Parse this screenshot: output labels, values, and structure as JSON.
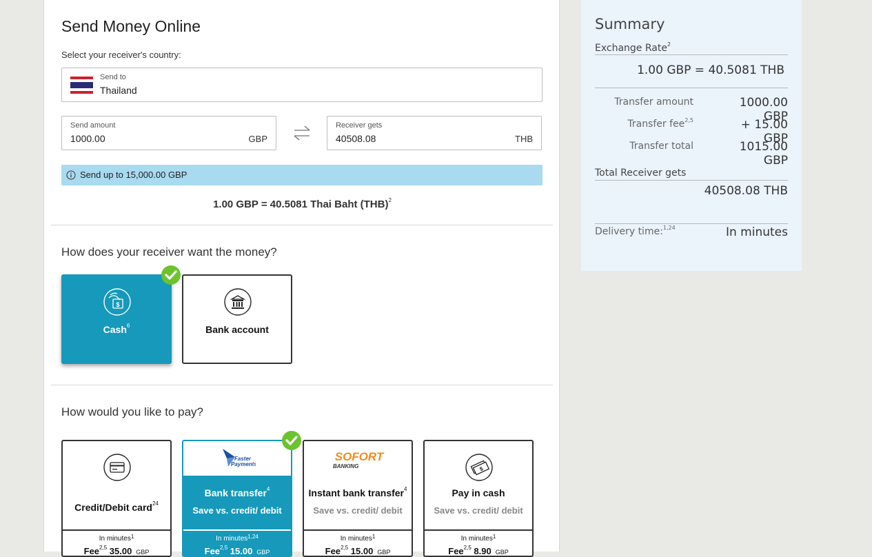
{
  "form": {
    "title": "Send Money Online",
    "country_label": "Select your receiver's country:",
    "send_to_label": "Send to",
    "country_value": "Thailand",
    "send_amount_label": "Send amount",
    "send_amount_value": "1000.00",
    "send_currency": "GBP",
    "receiver_gets_label": "Receiver gets",
    "receiver_gets_value": "40508.08",
    "receiver_currency": "THB",
    "limit_text": "Send up to 15,000.00 GBP",
    "rate_text": "1.00 GBP = 40.5081 Thai Baht (THB)",
    "rate_sup": "2"
  },
  "receive_method": {
    "title": "How does your receiver want the money?",
    "options": [
      {
        "label": "Cash",
        "sup": "6",
        "selected": true,
        "icon": "cash-hand-icon"
      },
      {
        "label": "Bank account",
        "sup": "",
        "selected": false,
        "icon": "bank-icon"
      }
    ]
  },
  "pay_method": {
    "title": "How would you like to pay?",
    "options": [
      {
        "label": "Credit/Debit card",
        "sup": "24",
        "sub": "",
        "speed": "In minutes",
        "speed_sup": "1",
        "fee_label": "Fee",
        "fee_sup": "2,5",
        "fee": "35.00",
        "ccy": "GBP",
        "icon": "credit-card-icon"
      },
      {
        "label": "Bank transfer",
        "sup": "4",
        "sub": "Save vs. credit/ debit",
        "speed": "In minutes",
        "speed_sup": "1,24",
        "fee_label": "Fee",
        "fee_sup": "2,5",
        "fee": "15.00",
        "ccy": "GBP",
        "icon": "faster-payments-logo",
        "logo_text_1": "Faster",
        "logo_text_2": "Payments",
        "selected": true
      },
      {
        "label": "Instant bank transfer",
        "sup": "4",
        "sub": "Save vs. credit/ debit",
        "speed": "In minutes",
        "speed_sup": "1",
        "fee_label": "Fee",
        "fee_sup": "2,5",
        "fee": "15.00",
        "ccy": "GBP",
        "icon": "sofort-logo",
        "logo_text_1": "SOFORT",
        "logo_text_2": "BANKING"
      },
      {
        "label": "Pay in cash",
        "sup": "",
        "sub": "Save vs. credit/ debit",
        "speed": "In minutes",
        "speed_sup": "1",
        "fee_label": "Fee",
        "fee_sup": "2,5",
        "fee": "8.90",
        "ccy": "GBP",
        "icon": "cash-stack-icon"
      }
    ]
  },
  "summary": {
    "title": "Summary",
    "exchange_rate_label": "Exchange Rate",
    "exchange_rate_sup": "2",
    "exchange_rate_value": "1.00 GBP = 40.5081 THB",
    "rows": [
      {
        "label": "Transfer amount",
        "sup": "",
        "value": "1000.00",
        "currency": "GBP"
      },
      {
        "label": "Transfer fee",
        "sup": "2,5",
        "value": "+ 15.00",
        "currency": "GBP"
      },
      {
        "label": "Transfer total",
        "sup": "",
        "value": "1015.00",
        "currency": "GBP"
      }
    ],
    "total_receiver_label": "Total Receiver gets",
    "total_receiver_value": "40508.08 THB",
    "delivery_label": "Delivery time:",
    "delivery_sup": "1,24",
    "delivery_value": "In minutes"
  },
  "colors": {
    "selected_tile": "#1699bb",
    "check": "#6cc32e",
    "info_bar": "#a8daf0",
    "summary_bg": "#ebf3fb",
    "sofort_orange": "#f28c1e",
    "faster_payments_blue": "#1b4fa0"
  }
}
